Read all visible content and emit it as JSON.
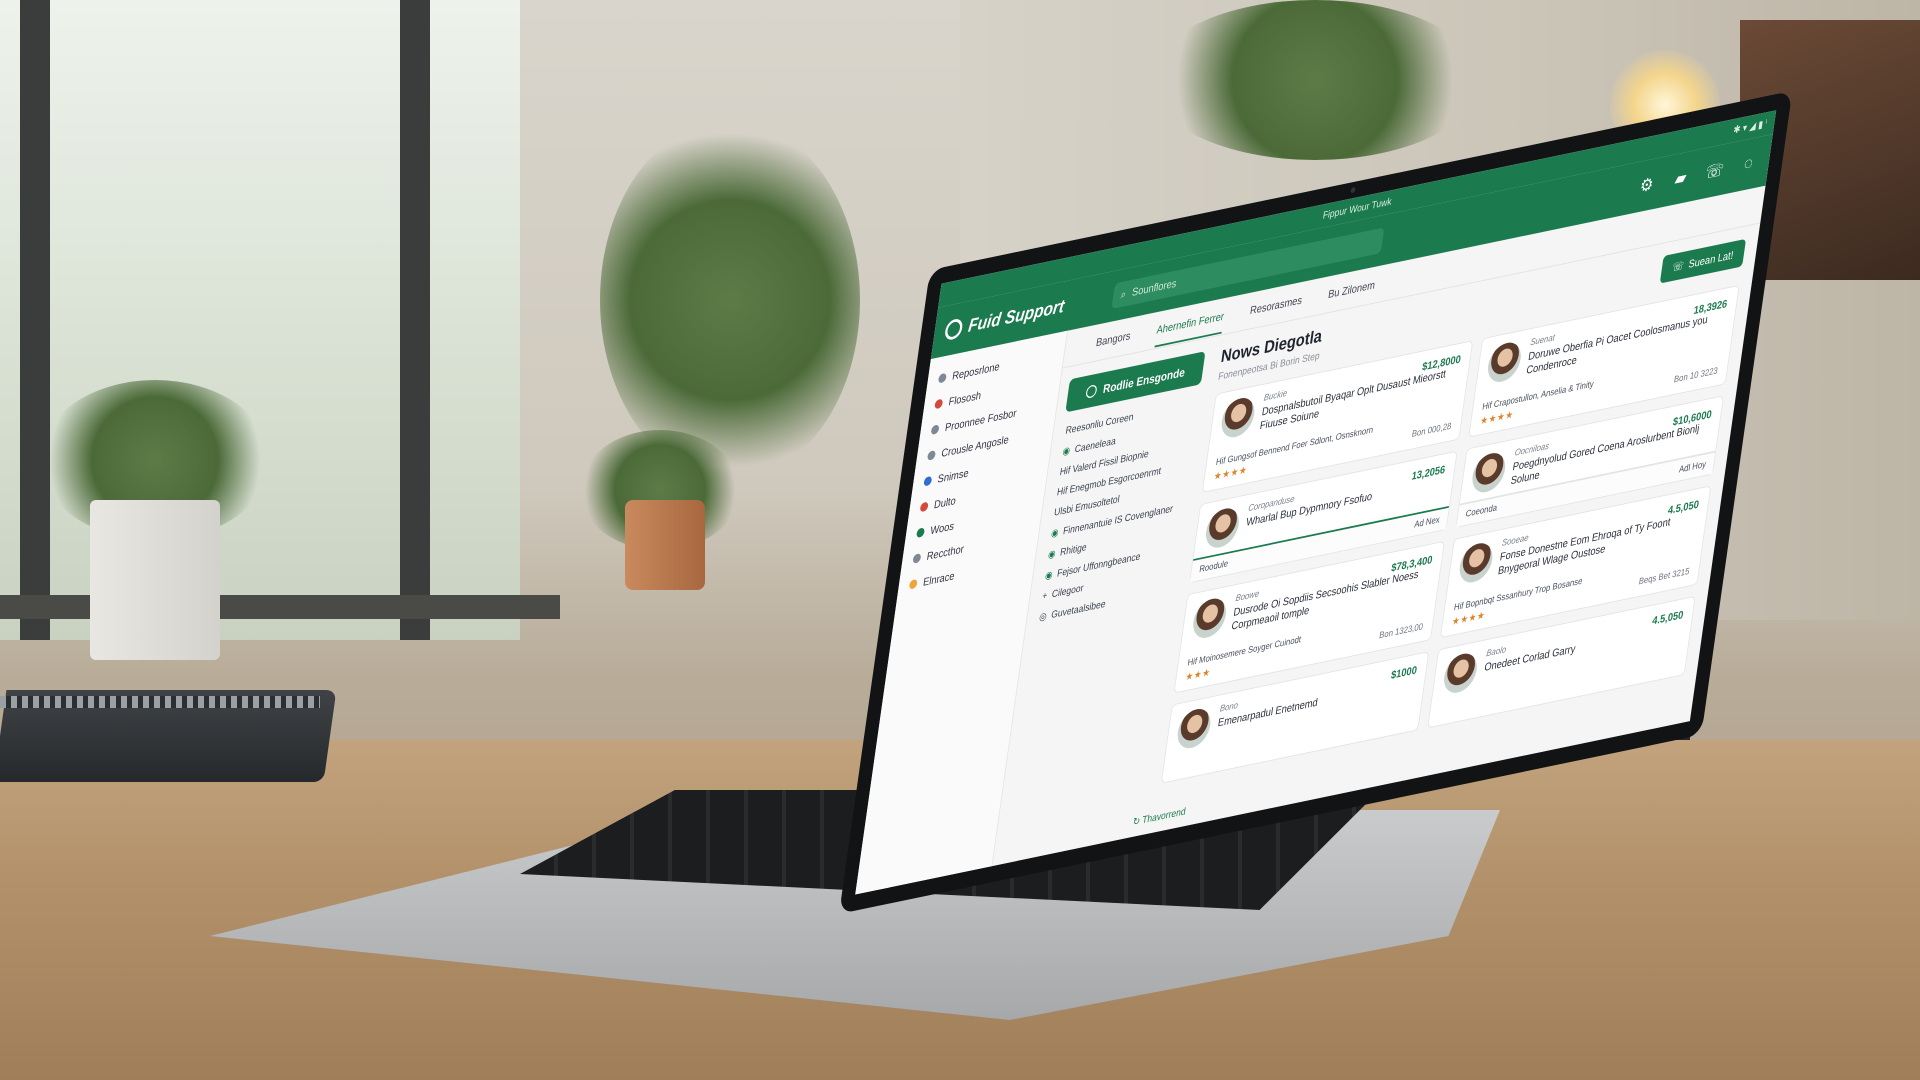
{
  "window": {
    "title": "Fippur Wour Tuwk",
    "system_tray": "✱ ▾ ◢ ▮ ⁱ"
  },
  "app": {
    "name": "Fuid Support",
    "logo_icon": "logo-icon"
  },
  "search": {
    "placeholder": "Sounflores"
  },
  "top_icons": [
    "gear-icon",
    "folder-icon",
    "phone-icon",
    "help-icon"
  ],
  "sidebar": {
    "items": [
      {
        "label": "Reposrlone",
        "color": "#7d8a95"
      },
      {
        "label": "Flososh",
        "color": "#d24b3a"
      },
      {
        "label": "Proonnee Fosbor",
        "color": "#7d8a95"
      },
      {
        "label": "Crousle Angosle",
        "color": "#7d8a95"
      },
      {
        "label": "Snimse",
        "color": "#2f6fd0"
      },
      {
        "label": "Dulto",
        "color": "#d24b3a"
      },
      {
        "label": "Woos",
        "color": "#1b7a4e"
      },
      {
        "label": "Reccthor",
        "color": "#7d8a95"
      },
      {
        "label": "Elnrace",
        "color": "#f0a53a"
      }
    ]
  },
  "tabs": [
    {
      "label": "Bangors",
      "active": false
    },
    {
      "label": "Ahernefin Ferrer",
      "active": true
    },
    {
      "label": "Resorasmes",
      "active": false
    },
    {
      "label": "Bu Zilonem",
      "active": false
    }
  ],
  "subnav": {
    "cta": "Rodlie Ensgonde",
    "items": [
      "Reesonliu Coreen",
      "Caeneleaa",
      "Hif Valerd Fissil Biopnie",
      "Hif Enegmob Esgorcoenrmt",
      "Ulsbi Emusoltetol",
      "Finnenantuie IS Covenglaner",
      "Rhitige",
      "Fejsor Uffonngbeance",
      "Cilegoor",
      "Guvetaalsibee"
    ],
    "footer": "Thavorrend"
  },
  "panel": {
    "title": "Nows Diegotla",
    "subtitle": "Fonenpeotsa Bi Borin Step",
    "primary_button": "Suean Lat!"
  },
  "cards": [
    {
      "meta": "Buckie",
      "title": "Dospnalsbutoil Byaqar Oplt Dusaust Mieorstt Fiuuse Soiune",
      "amount": "$12,8000",
      "line": "Hif Gungsof Bennend Foer Sdlont, Osnsknorn",
      "stars": "★★★★",
      "date": "Bon 000,28"
    },
    {
      "meta": "Suenat",
      "title": "Doruwe Oberfia Pi Oacet Coolosmanus you Condenroce",
      "amount": "18,3926",
      "line": "Hif Crapostullon, Anselia & Tinity",
      "stars": "★★★★",
      "date": "Bon 10 3223"
    },
    {
      "meta": "Coropanduse",
      "title": "Wharlal Bup Dypmnory Fsofuo",
      "amount": "13,2056",
      "bar_left": "Roodule",
      "bar_right": "Ad Nex"
    },
    {
      "meta": "Oocniloas",
      "title": "Poegdnyolud Gored Coena Aroslurbent Bionlj Solune",
      "amount": "$10,6000",
      "bar_left": "Coeonda",
      "bar_right": "Adl Hoy"
    },
    {
      "meta": "Boowe",
      "title": "Dusrode Oi Sopdiis Secsoohis Slabler Noess Corpmeaoil tomple",
      "amount": "$78,3,400",
      "line": "Hif Moinosemere Soyger Cuinodt",
      "stars": "★★★",
      "date": "Bon 1323,00"
    },
    {
      "meta": "Sooeae",
      "title": "Fonse Donestne Eom Ehroqa of Ty Foont Bnygeoral Wlage Oustose",
      "amount": "4.5,050",
      "line": "Hif Bopnbqt Sssanhury Trop Bosanse",
      "stars": "★★★★",
      "date": "Beqs Bet 3215"
    },
    {
      "meta": "Bono",
      "title": "Emenarpadul Enetnemd",
      "amount": "$1000"
    },
    {
      "meta": "Baolo",
      "title": "Onedeet Corlad Garry",
      "amount": "4.5,050"
    }
  ]
}
